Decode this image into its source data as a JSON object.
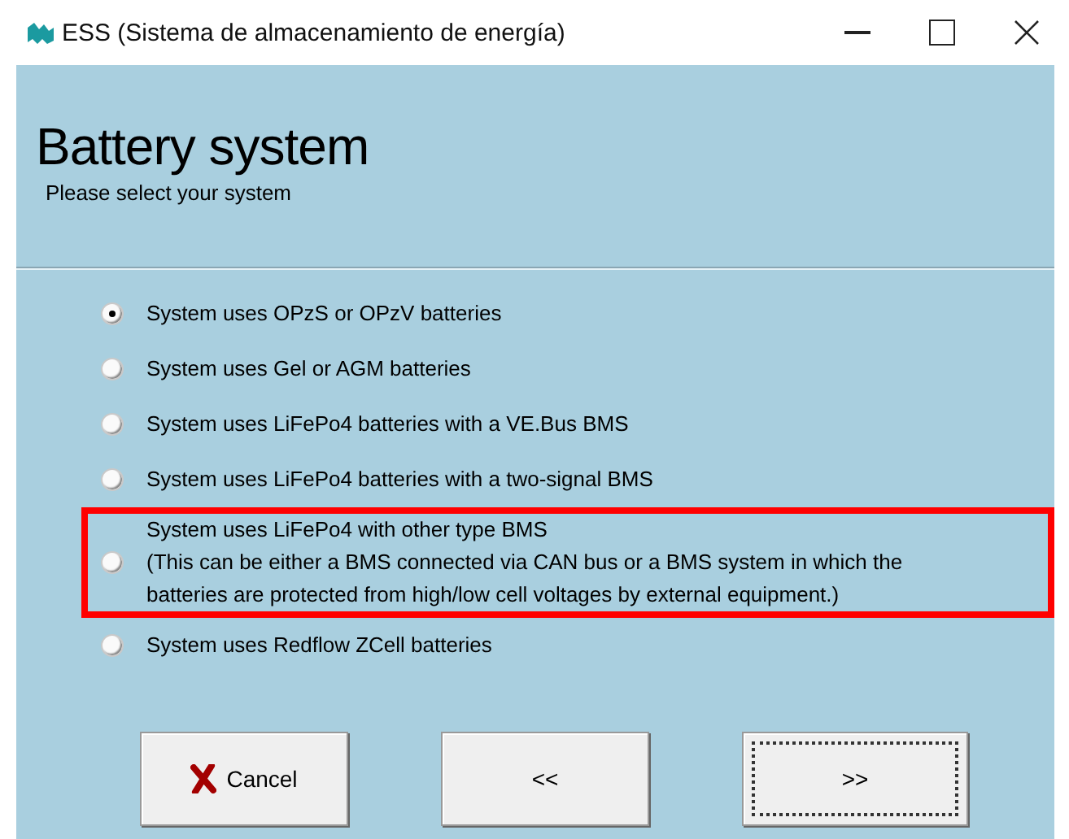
{
  "window": {
    "title": "ESS (Sistema de almacenamiento de energía)"
  },
  "header": {
    "title": "Battery system",
    "subtitle": "Please select your system"
  },
  "options": [
    {
      "lines": [
        "System uses OPzS or OPzV batteries"
      ],
      "selected": true,
      "highlighted": false
    },
    {
      "lines": [
        "System uses Gel or AGM batteries"
      ],
      "selected": false,
      "highlighted": false
    },
    {
      "lines": [
        "System uses LiFePo4 batteries with a VE.Bus BMS"
      ],
      "selected": false,
      "highlighted": false
    },
    {
      "lines": [
        "System uses LiFePo4 batteries with a two-signal BMS"
      ],
      "selected": false,
      "highlighted": false
    },
    {
      "lines": [
        "System uses LiFePo4 with other type BMS",
        "(This can be either a BMS connected via CAN bus or a BMS system in which the",
        "batteries are protected from high/low cell voltages by external equipment.)"
      ],
      "selected": false,
      "highlighted": true
    },
    {
      "lines": [
        "System uses Redflow ZCell batteries"
      ],
      "selected": false,
      "highlighted": false
    }
  ],
  "buttons": [
    {
      "kind": "cancel",
      "label": "Cancel",
      "focused": false
    },
    {
      "kind": "back",
      "label": "<<",
      "focused": false
    },
    {
      "kind": "next",
      "label": ">>",
      "focused": true
    }
  ]
}
